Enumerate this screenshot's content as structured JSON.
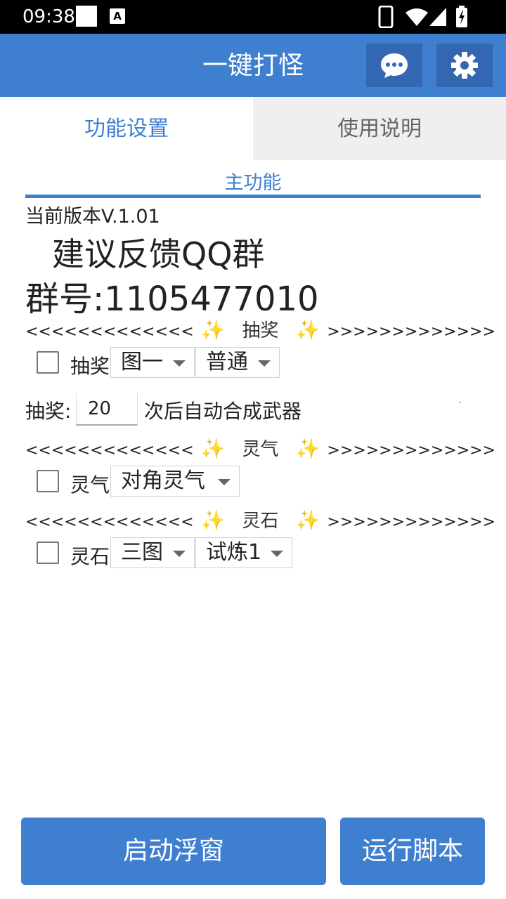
{
  "status_bar": {
    "time": "09:38",
    "notification_badge": "A"
  },
  "app_bar": {
    "title": "一键打怪",
    "chat_icon": "chat-bubble-icon",
    "settings_icon": "gear-icon"
  },
  "tabs": [
    {
      "label": "功能设置",
      "active": true
    },
    {
      "label": "使用说明",
      "active": false
    }
  ],
  "main": {
    "section_title": "主功能",
    "version": "当前版本V.1.01",
    "feedback": "建议反馈QQ群",
    "group_number": "群号:1105477010"
  },
  "sections": {
    "lottery": {
      "divider_left": "<<<<<<<<<<<<<",
      "divider_title": "抽奖",
      "divider_right": ">>>>>>>>>>>>>",
      "checkbox_label": "抽奖",
      "select1": "图一",
      "select2": "普通",
      "count_label": "抽奖:",
      "count_value": "20",
      "count_suffix": "次后自动合成武器"
    },
    "aura": {
      "divider_left": "<<<<<<<<<<<<<",
      "divider_title": "灵气",
      "divider_right": ">>>>>>>>>>>>>",
      "checkbox_label": "灵气",
      "select1": "对角灵气"
    },
    "stone": {
      "divider_left": "<<<<<<<<<<<<<",
      "divider_title": "灵石",
      "divider_right": ">>>>>>>>>>>>>",
      "checkbox_label": "灵石",
      "select1": "三图",
      "select2": "试炼1"
    }
  },
  "buttons": {
    "start_float": "启动浮窗",
    "run_script": "运行脚本"
  },
  "colors": {
    "primary": "#3f7fd0",
    "primary_dark": "#3467b2",
    "sparkle": "#f5c518"
  }
}
